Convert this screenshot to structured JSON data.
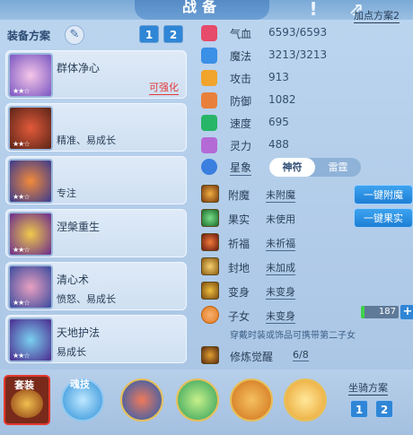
{
  "header": {
    "title": "战备"
  },
  "equip_scheme": {
    "label": "装备方案",
    "tabs": [
      "1",
      "2"
    ],
    "active": "2"
  },
  "cards": [
    {
      "name": "群体净心",
      "sub": "",
      "enhance": "可强化",
      "stars": "★★☆"
    },
    {
      "name": "精准、易成长",
      "sub": "",
      "enhance": "",
      "stars": "★★☆"
    },
    {
      "name": "专注",
      "sub": "",
      "enhance": "",
      "stars": "★★☆"
    },
    {
      "name": "涅槃重生",
      "sub": "",
      "enhance": "",
      "stars": "★★☆"
    },
    {
      "name": "清心术",
      "sub": "愤怒、易成长",
      "enhance": "",
      "stars": "★★☆"
    },
    {
      "name": "天地护法",
      "sub": "易成长",
      "enhance": "",
      "stars": "★★☆"
    }
  ],
  "stats": [
    {
      "label": "气血",
      "value": "6593/6593",
      "color": "#e74a6a"
    },
    {
      "label": "魔法",
      "value": "3213/3213",
      "color": "#3a8fe6"
    },
    {
      "label": "攻击",
      "value": "913",
      "color": "#f0a42c"
    },
    {
      "label": "防御",
      "value": "1082",
      "color": "#e9803a"
    },
    {
      "label": "速度",
      "value": "695",
      "color": "#27b567"
    },
    {
      "label": "灵力",
      "value": "488",
      "color": "#b46ad6"
    }
  ],
  "alloc_label": "加点方案2",
  "star_sign": {
    "label": "星象",
    "opt_on": "神符",
    "opt_off": "雷霆"
  },
  "details": [
    {
      "label": "附魔",
      "value": "未附魔"
    },
    {
      "label": "果实",
      "value": "未使用"
    },
    {
      "label": "祈福",
      "value": "未祈福"
    },
    {
      "label": "封地",
      "value": "未加成"
    },
    {
      "label": "变身",
      "value": "未变身"
    },
    {
      "label": "子女",
      "value": "未变身"
    }
  ],
  "btn_enchant": "一键附魔",
  "btn_fruit": "一键果实",
  "pet_value": "187",
  "hint": "穿戴时装或饰品可携带第二子女",
  "awaken": {
    "label": "修炼觉醒",
    "value": "6/8"
  },
  "bottom_tabs": {
    "suit": "套装",
    "soul": "魂技"
  },
  "mount": {
    "label": "坐骑方案",
    "tabs": [
      "1",
      "2"
    ]
  },
  "colors": {
    "accent": "#2f86d6",
    "enhance": "#e23b3b"
  }
}
